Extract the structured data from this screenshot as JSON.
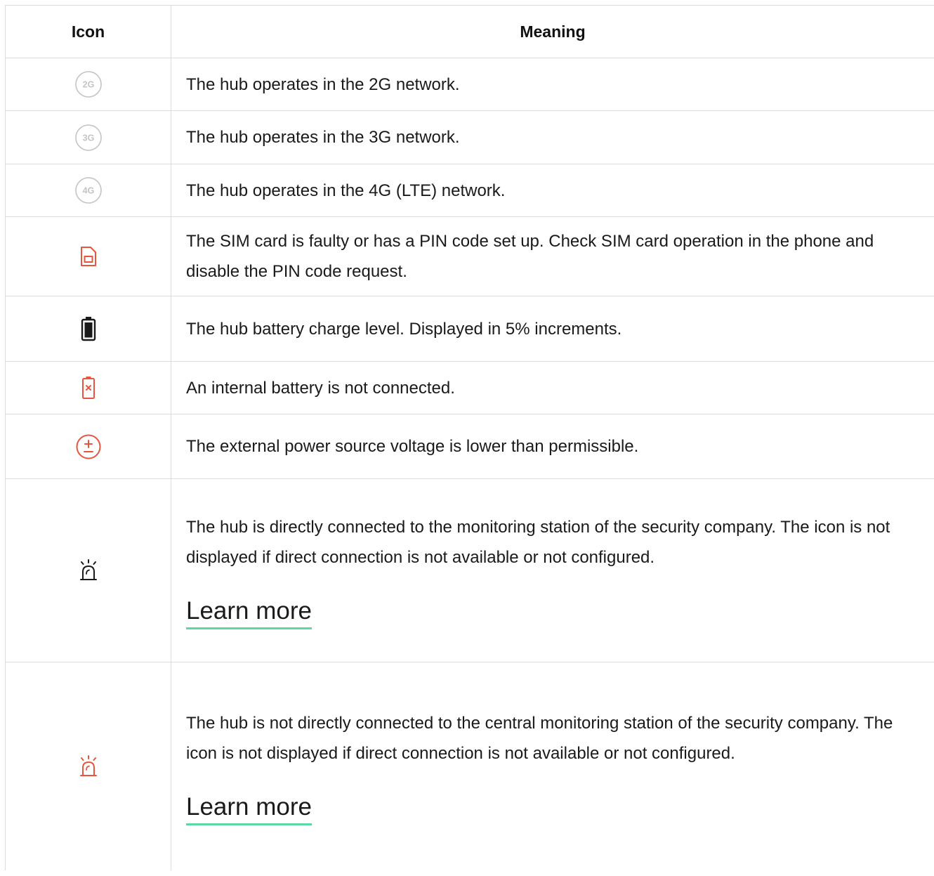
{
  "table": {
    "headers": {
      "icon": "Icon",
      "meaning": "Meaning"
    },
    "rows": [
      {
        "icon": "2g-network-icon",
        "icon_label": "2G",
        "meaning": "The hub operates in the 2G network."
      },
      {
        "icon": "3g-network-icon",
        "icon_label": "3G",
        "meaning": "The hub operates in the 3G network."
      },
      {
        "icon": "4g-network-icon",
        "icon_label": "4G",
        "meaning": "The hub operates in the 4G (LTE) network."
      },
      {
        "icon": "sim-card-fault-icon",
        "meaning": "The SIM card is faulty or has a PIN code set up. Check SIM card operation in the phone and disable the PIN code request."
      },
      {
        "icon": "battery-level-icon",
        "meaning": "The hub battery charge level. Displayed in 5% increments."
      },
      {
        "icon": "battery-disconnected-icon",
        "meaning": "An internal battery is not connected."
      },
      {
        "icon": "power-voltage-low-icon",
        "meaning": "The external power source voltage is lower than permissible."
      },
      {
        "icon": "siren-connected-icon",
        "meaning": "The hub is directly connected to the monitoring station of the security company. The icon is not displayed if direct connection is not available or not configured.",
        "link": "Learn more"
      },
      {
        "icon": "siren-disconnected-icon",
        "meaning": "The hub is not directly connected to the central monitoring station of the security company. The icon is not displayed if direct connection is not available or not configured.",
        "link": "Learn more"
      }
    ]
  },
  "colors": {
    "grey_icon": "#c4c4c4",
    "alert_red": "#e8553f",
    "dark_icon": "#1a1a1a",
    "link_underline": "#5ad9a5",
    "border": "#dcdcdc"
  }
}
